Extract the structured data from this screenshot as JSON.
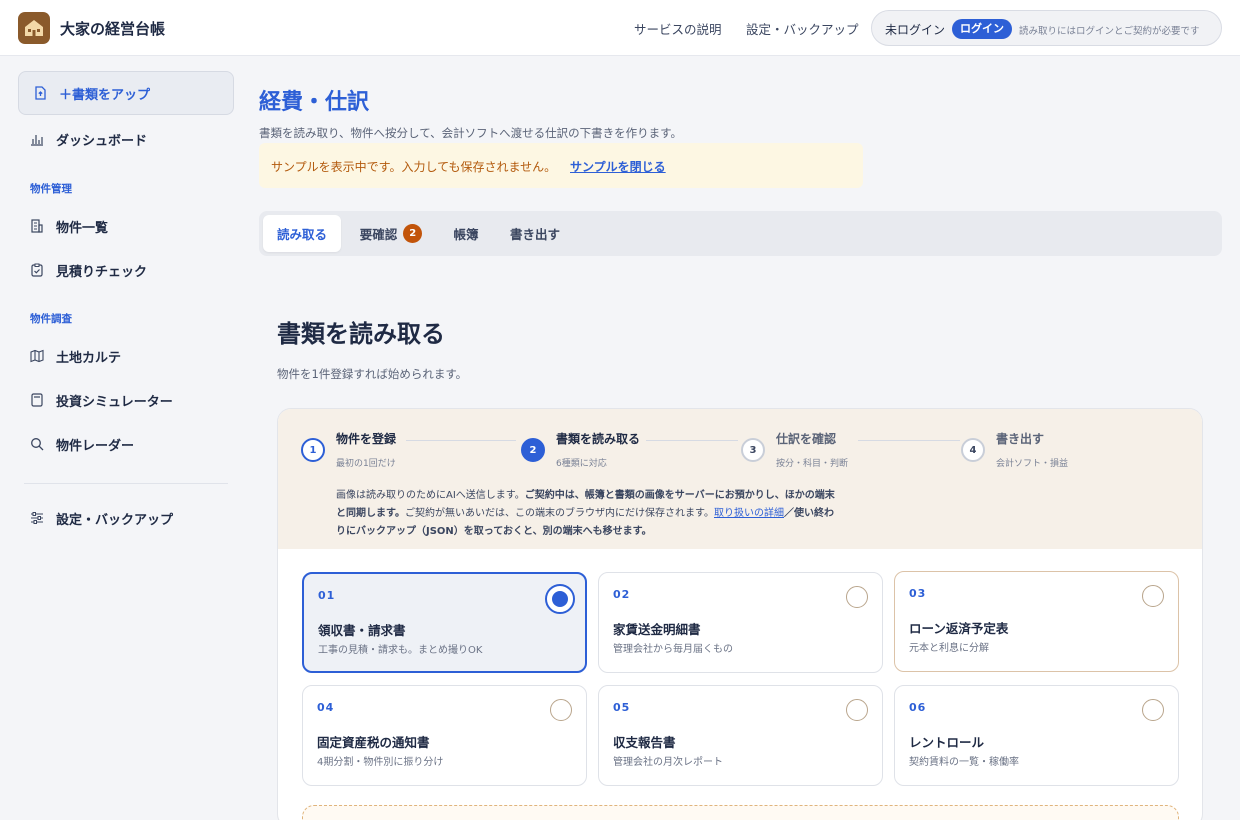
{
  "header": {
    "app_name": "大家の経営台帳",
    "nav": [
      "サービスの説明",
      "設定・バックアップ"
    ],
    "login_status": "未ログイン",
    "login_button": "ログイン",
    "login_note": "読み取りにはログインとご契約が必要です"
  },
  "sidebar": {
    "upload": "＋書類をアップ",
    "dashboard": "ダッシュボード",
    "section_property": "物件管理",
    "property_list": "物件一覧",
    "estimate_check": "見積りチェック",
    "section_research": "物件調査",
    "land_chart": "土地カルテ",
    "simulator": "投資シミュレーター",
    "radar": "物件レーダー",
    "settings": "設定・バックアップ"
  },
  "main": {
    "title": "経費・仕訳",
    "description": "書類を読み取り、物件へ按分して、会計ソフトへ渡せる仕訳の下書きを作ります。",
    "sample_notice": "サンプルを表示中です。入力しても保存されません。",
    "sample_close": "サンプルを閉じる",
    "tabs": [
      {
        "label": "読み取る"
      },
      {
        "label": "要確認",
        "badge": "2"
      },
      {
        "label": "帳簿"
      },
      {
        "label": "書き出す"
      }
    ],
    "section_title": "書類を読み取る",
    "section_desc": "物件を1件登録すれば始められます。"
  },
  "steps": [
    {
      "num": "1",
      "label": "物件を登録",
      "sub": "最初の1回だけ"
    },
    {
      "num": "2",
      "label": "書類を読み取る",
      "sub": "6種類に対応"
    },
    {
      "num": "3",
      "label": "仕訳を確認",
      "sub": "按分・科目・判断"
    },
    {
      "num": "4",
      "label": "書き出す",
      "sub": "会計ソフト・損益"
    }
  ],
  "notice": {
    "p1": "画像は読み取りのためにAIへ送信します。",
    "p2": "ご契約中は、帳簿と書類の画像をサーバーにお預かりし、ほかの端末と同期します。",
    "p3": "ご契約が無いあいだは、この端末のブラウザ内にだけ保存されます。",
    "link": "取り扱いの詳細",
    "p4": "／使い終わりにバックアップ（JSON）を取っておくと、別の端末へも移せます。"
  },
  "documents": [
    {
      "num": "01",
      "title": "領収書・請求書",
      "sub": "工事の見積・請求も。まとめ撮りOK"
    },
    {
      "num": "02",
      "title": "家賃送金明細書",
      "sub": "管理会社から毎月届くもの"
    },
    {
      "num": "03",
      "title": "ローン返済予定表",
      "sub": "元本と利息に分解"
    },
    {
      "num": "04",
      "title": "固定資産税の通知書",
      "sub": "4期分割・物件別に振り分け"
    },
    {
      "num": "05",
      "title": "収支報告書",
      "sub": "管理会社の月次レポート"
    },
    {
      "num": "06",
      "title": "レントロール",
      "sub": "契約賃料の一覧・稼働率"
    }
  ],
  "colors": {
    "accent": "#2d5fd6",
    "badge": "#c2540a",
    "warn_text": "#b35a0d",
    "warn_bg": "#fdf7e3"
  }
}
